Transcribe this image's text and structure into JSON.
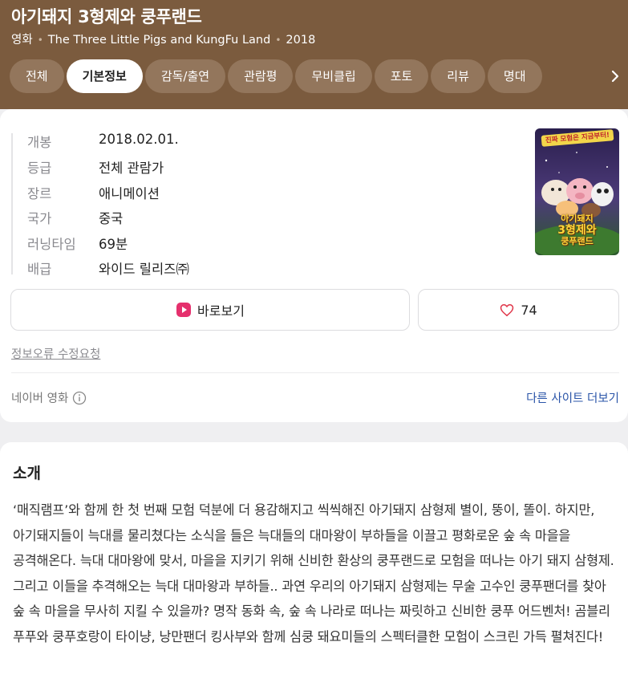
{
  "header": {
    "title": "아기돼지 3형제와 쿵푸랜드",
    "category": "영화",
    "original_title": "The Three Little Pigs and KungFu Land",
    "year": "2018"
  },
  "tabs": [
    {
      "label": "전체",
      "active": false
    },
    {
      "label": "기본정보",
      "active": true
    },
    {
      "label": "감독/출연",
      "active": false
    },
    {
      "label": "관람평",
      "active": false
    },
    {
      "label": "무비클립",
      "active": false
    },
    {
      "label": "포토",
      "active": false
    },
    {
      "label": "리뷰",
      "active": false
    },
    {
      "label": "명대",
      "active": false
    }
  ],
  "info": [
    {
      "label": "개봉",
      "value": "2018.02.01."
    },
    {
      "label": "등급",
      "value": "전체 관람가"
    },
    {
      "label": "장르",
      "value": "애니메이션"
    },
    {
      "label": "국가",
      "value": "중국"
    },
    {
      "label": "러닝타임",
      "value": "69분"
    },
    {
      "label": "배급",
      "value": "와이드 릴리즈㈜"
    }
  ],
  "poster": {
    "banner": "진짜 모험은 지금부터!",
    "title_line1": "아기돼지",
    "title_line2": "3형제와",
    "title_line3": "쿵푸랜드",
    "icon": "movie-poster"
  },
  "actions": {
    "watch_label": "바로보기",
    "like_count": "74",
    "watch_icon": "play-icon",
    "like_icon": "heart-icon"
  },
  "report_link": "정보오류 수정요청",
  "source": {
    "label": "네이버 영화",
    "info_icon": "info-icon",
    "more_link": "다른 사이트 더보기"
  },
  "synopsis": {
    "title": "소개",
    "text": "‘매직램프’와 함께 한 첫 번째 모험 덕분에 더 용감해지고 씩씩해진 아기돼지 삼형제 별이, 뚱이, 똘이. 하지만, 아기돼지들이 늑대를 물리쳤다는 소식을 들은 늑대들의 대마왕이 부하들을 이끌고 평화로운 숲 속 마을을 공격해온다. 늑대 대마왕에 맞서, 마을을 지키기 위해 신비한 환상의 쿵푸랜드로 모험을 떠나는 아기 돼지 삼형제. 그리고 이들을 추격해오는 늑대 대마왕과 부하들.. 과연 우리의 아기돼지 삼형제는 무술 고수인 쿵푸팬더를 찾아 숲 속 마을을 무사히 지킬 수 있을까? 명작 동화 속, 숲 속 나라로 떠나는 짜릿하고 신비한 쿵푸 어드벤처! 곰블리 푸푸와 쿵푸호랑이 타이냥, 낭만팬더 킹사부와 함께 심쿵 돼요미들의 스펙터클한 모험이 스크린 가득 펼쳐진다!"
  },
  "colors": {
    "header_bg": "#7b5b3e",
    "tab_bg": "#93765c",
    "link_blue": "#2a54a8",
    "heart": "#e0384b",
    "play_pink": "#e5306d"
  }
}
